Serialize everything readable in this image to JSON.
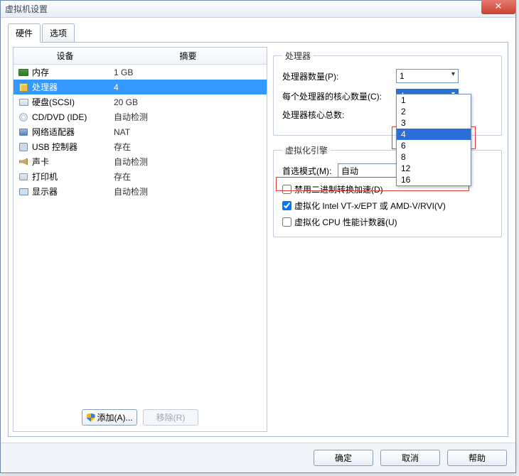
{
  "window": {
    "title": "虚拟机设置"
  },
  "tabs": [
    {
      "label": "硬件",
      "active": true
    },
    {
      "label": "选项",
      "active": false
    }
  ],
  "hw_table": {
    "col_device": "设备",
    "col_summary": "摘要",
    "rows": [
      {
        "name": "内存",
        "summary": "1 GB",
        "icon": "memory-icon"
      },
      {
        "name": "处理器",
        "summary": "4",
        "icon": "cpu-icon",
        "selected": true
      },
      {
        "name": "硬盘(SCSI)",
        "summary": "20 GB",
        "icon": "disk-icon"
      },
      {
        "name": "CD/DVD (IDE)",
        "summary": "自动检测",
        "icon": "cd-icon"
      },
      {
        "name": "网络适配器",
        "summary": "NAT",
        "icon": "net-icon"
      },
      {
        "name": "USB 控制器",
        "summary": "存在",
        "icon": "usb-icon"
      },
      {
        "name": "声卡",
        "summary": "自动检测",
        "icon": "sound-icon"
      },
      {
        "name": "打印机",
        "summary": "存在",
        "icon": "printer-icon"
      },
      {
        "name": "显示器",
        "summary": "自动检测",
        "icon": "display-icon"
      }
    ]
  },
  "hw_buttons": {
    "add": "添加(A)...",
    "remove": "移除(R)"
  },
  "proc_group": {
    "legend": "处理器",
    "count_label": "处理器数量(P):",
    "count_value": "1",
    "cores_label": "每个处理器的核心数量(C):",
    "cores_value": "4",
    "total_label": "处理器核心总数:",
    "dropdown_options": [
      "1",
      "2",
      "3",
      "4",
      "6",
      "8",
      "12",
      "16"
    ],
    "dropdown_highlight": "4"
  },
  "virt_group": {
    "legend": "虚拟化引擎",
    "mode_label": "首选模式(M):",
    "mode_value": "自动",
    "cb_binary": {
      "label": "禁用二进制转换加速(D)",
      "checked": false
    },
    "cb_vt": {
      "label": "虚拟化 Intel VT-x/EPT 或 AMD-V/RVI(V)",
      "checked": true
    },
    "cb_cpu": {
      "label": "虚拟化 CPU 性能计数器(U)",
      "checked": false
    }
  },
  "footer": {
    "ok": "确定",
    "cancel": "取消",
    "help": "帮助"
  }
}
